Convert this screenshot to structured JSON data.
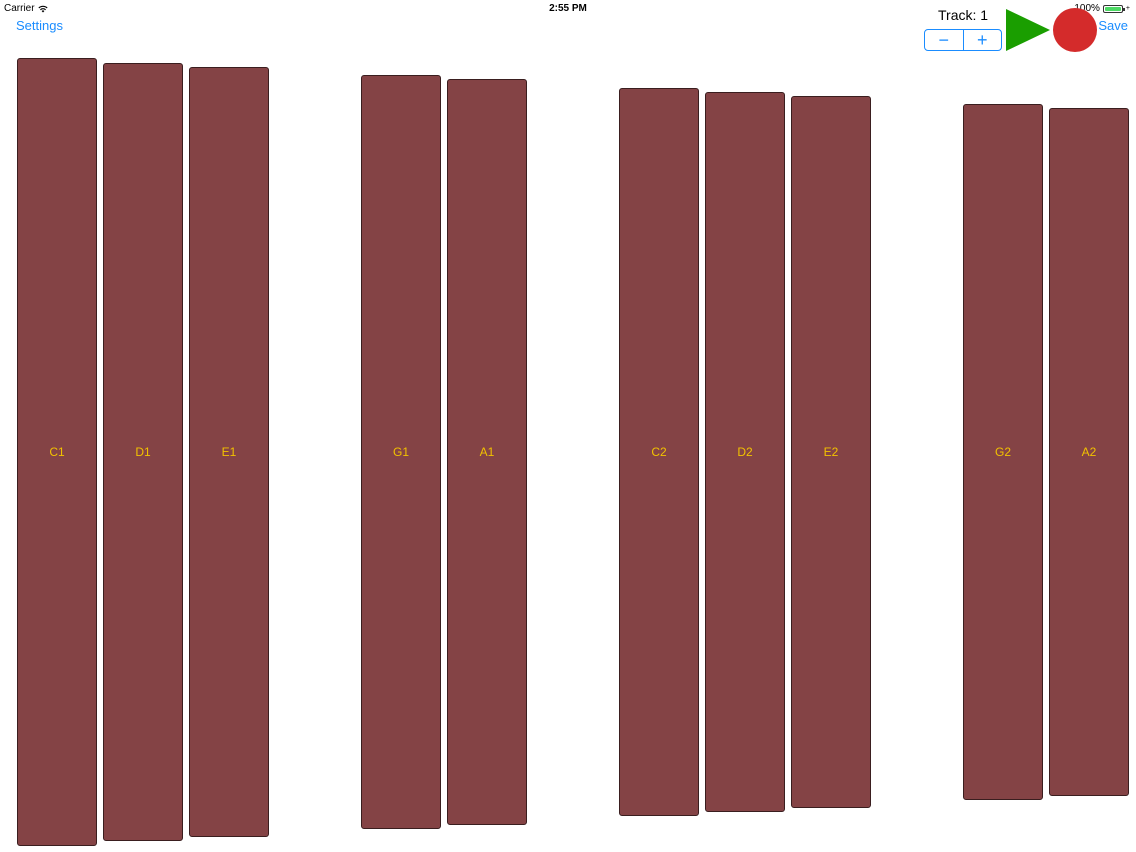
{
  "status_bar": {
    "carrier": "Carrier",
    "time": "2:55 PM",
    "battery": "100%"
  },
  "nav": {
    "settings_label": "Settings",
    "save_label": "Save"
  },
  "track": {
    "label": "Track: 1",
    "decrement_label": "−",
    "increment_label": "+"
  },
  "colors": {
    "key_fill": "#844345",
    "key_label": "#f2c200",
    "accent": "#1a8cff",
    "play": "#1a9e00",
    "record": "#d42b2b"
  },
  "keys": [
    {
      "label": "C1"
    },
    {
      "label": "D1"
    },
    {
      "label": "E1"
    },
    {
      "label": "G1"
    },
    {
      "label": "A1"
    },
    {
      "label": "C2"
    },
    {
      "label": "D2"
    },
    {
      "label": "E2"
    },
    {
      "label": "G2"
    },
    {
      "label": "A2"
    }
  ],
  "icons": {
    "wifi": "wifi-icon",
    "battery": "battery-icon",
    "play": "play-icon",
    "record": "record-icon"
  }
}
